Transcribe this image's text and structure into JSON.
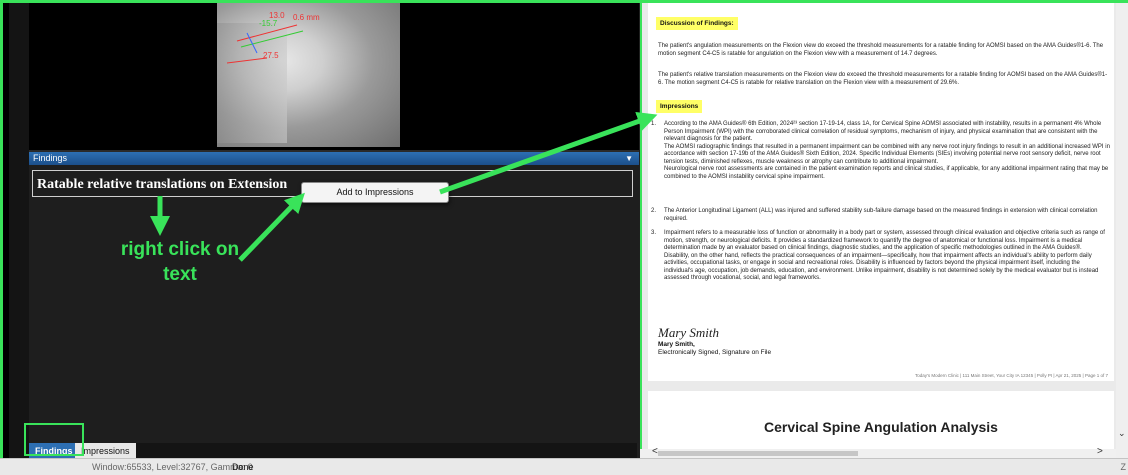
{
  "left_panel": {
    "xray": {
      "labels": [
        "13.0",
        "-15.7",
        "0.6 mm",
        "27.5"
      ]
    },
    "findings_header": "Findings",
    "finding_row": "Ratable relative translations on Extension",
    "context_menu_item": "Add to Impressions",
    "annotation_text": "right click on text",
    "tabs": [
      "Findings",
      "Impressions"
    ]
  },
  "status_bar": {
    "window_level": "Window:65533, Level:32767, Gamma: 0",
    "status": "Done",
    "right_char": "Z"
  },
  "document": {
    "discussion_heading": "Discussion of Findings:",
    "discussion_p1": "The patient's angulation measurements on the Flexion view do exceed the threshold measurements for a ratable finding for AOMSI based on the AMA Guides®1-6. The motion segment C4-C5 is ratable for angulation on the Flexion view with a measurement of 14.7 degrees.",
    "discussion_p2": "The patient's relative translation measurements on the Flexion view do exceed the threshold measurements for a ratable finding for AOMSI based on the AMA Guides®1-6. The motion segment C4-C5 is ratable for relative translation on the Flexion view with a measurement of 29.6%.",
    "impressions_heading": "Impressions",
    "item1_p1": "According to the AMA Guides® 6th Edition, 2024²³ section 17-19-14, class 1A, for Cervical Spine AOMSI associated with instability, results in a permanent 4% Whole Person Impairment (WPI) with the corroborated clinical correlation of residual symptoms, mechanism of injury, and physical examination that are consistent with the relevant diagnosis for the patient.",
    "item1_p2": "The AOMSI radiographic findings that resulted in a permanent impairment can be combined with any nerve root injury findings to result in an additional increased WPI in accordance with section 17-19b of the AMA Guides® Sixth Edition, 2024. Specific Individual Elements (SIEs) involving potential nerve root sensory deficit, nerve root tension tests, diminished reflexes, muscle weakness or atrophy can contribute to additional impairment.",
    "item1_p3": "Neurological nerve root assessments are contained in the patient examination reports and clinical studies, if applicable, for any additional impairment rating that may be combined to the AOMSI instability cervical spine impairment.",
    "item2": "The Anterior Longitudinal Ligament (ALL) was injured and suffered stability sub-failure damage based on the measured findings in extension with clinical correlation required.",
    "item3_p1": "Impairment refers to a measurable loss of function or abnormality in a body part or system, assessed through clinical evaluation and objective criteria such as range of motion, strength, or neurological deficits. It provides a standardized framework to quantify the degree of anatomical or functional loss. Impairment is a medical determination made by an evaluator based on clinical findings, diagnostic studies, and the application of specific methodologies outlined in the AMA Guides®.",
    "item3_p2": "Disability, on the other hand, reflects the practical consequences of an impairment—specifically, how that impairment affects an individual's ability to perform daily activities, occupational tasks, or engage in social and recreational roles. Disability is influenced by factors beyond the physical impairment itself, including the individual's age, occupation, job demands, education, and environment. Unlike impairment, disability is not determined solely by the medical evaluator but is instead assessed through vocational, social, and legal frameworks.",
    "signature_script": "Mary Smith",
    "signature_name": "Mary Smith,",
    "signature_line": "Electronically Signed, Signature on File",
    "footer": "Today's Modern Clinic | 111 Main Street, Your City IA 12345 | Polly PI | Apr 21, 2025 | Page 1 of 7",
    "page2_title": "Cervical Spine Angulation Analysis"
  },
  "colors": {
    "annotation_green": "#39e35a",
    "header_blue": "#2d6fb3",
    "highlight_yellow": "#ffff66"
  },
  "icons": [
    "chevron-down-icon",
    "scroll-left-arrow-icon",
    "scroll-right-arrow-icon",
    "chevron-down-icon"
  ]
}
